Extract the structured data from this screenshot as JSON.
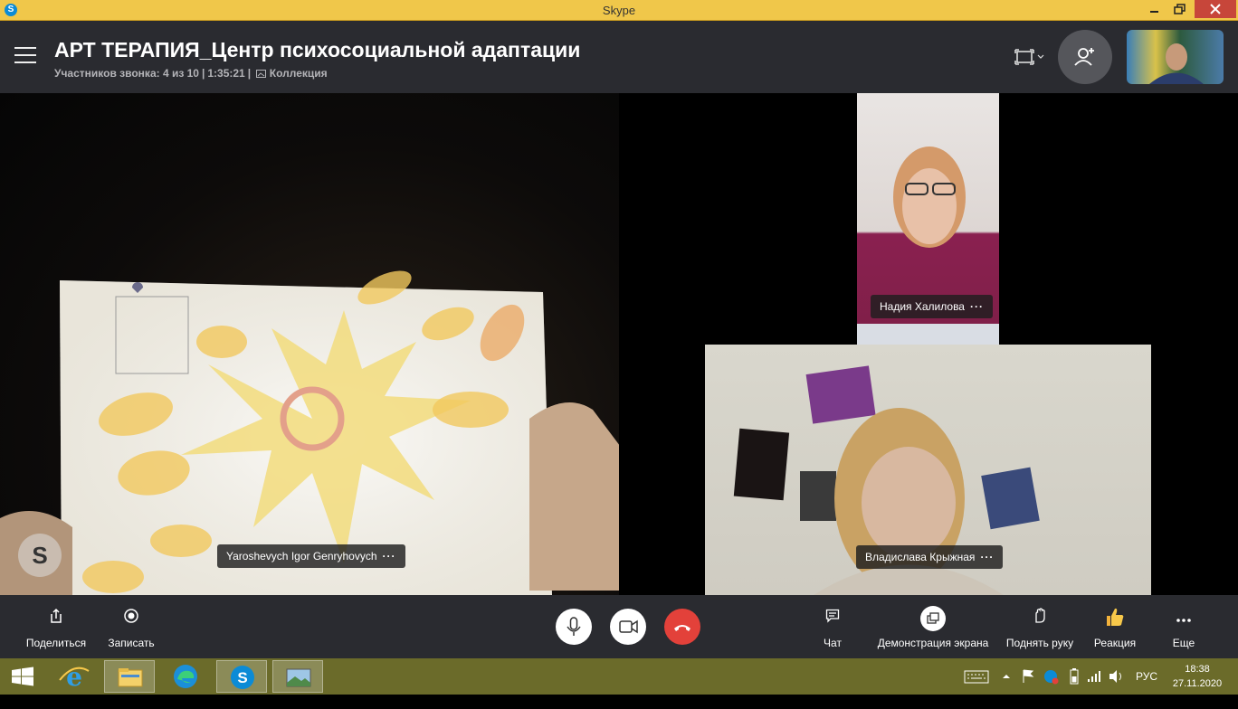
{
  "window": {
    "title": "Skype",
    "app_icon": "S"
  },
  "call": {
    "title": "АРТ ТЕРАПИЯ_Центр психосоциальной адаптации",
    "participants": "Участников звонка: 4 из 10",
    "duration": "1:35:21",
    "collection": "Коллекция"
  },
  "videos": [
    {
      "name": "Yaroshevych Igor Genryhovych",
      "menu": "···"
    },
    {
      "name": "Надия Халилова",
      "menu": "···"
    },
    {
      "name": "Владислава  Крыжная",
      "menu": "···"
    }
  ],
  "watermark": "S",
  "controls": {
    "share": "Поделиться",
    "record": "Записать",
    "chat": "Чат",
    "screen_share": "Демонстрация экрана",
    "raise_hand": "Поднять руку",
    "reaction": "Реакция",
    "more": "Еще"
  },
  "taskbar": {
    "language": "РУС",
    "time": "18:38",
    "date": "27.11.2020"
  },
  "colors": {
    "titlebar": "#f0c74a",
    "header": "#2a2b30",
    "hangup": "#e3413a",
    "taskbar": "#6b6b2a"
  }
}
